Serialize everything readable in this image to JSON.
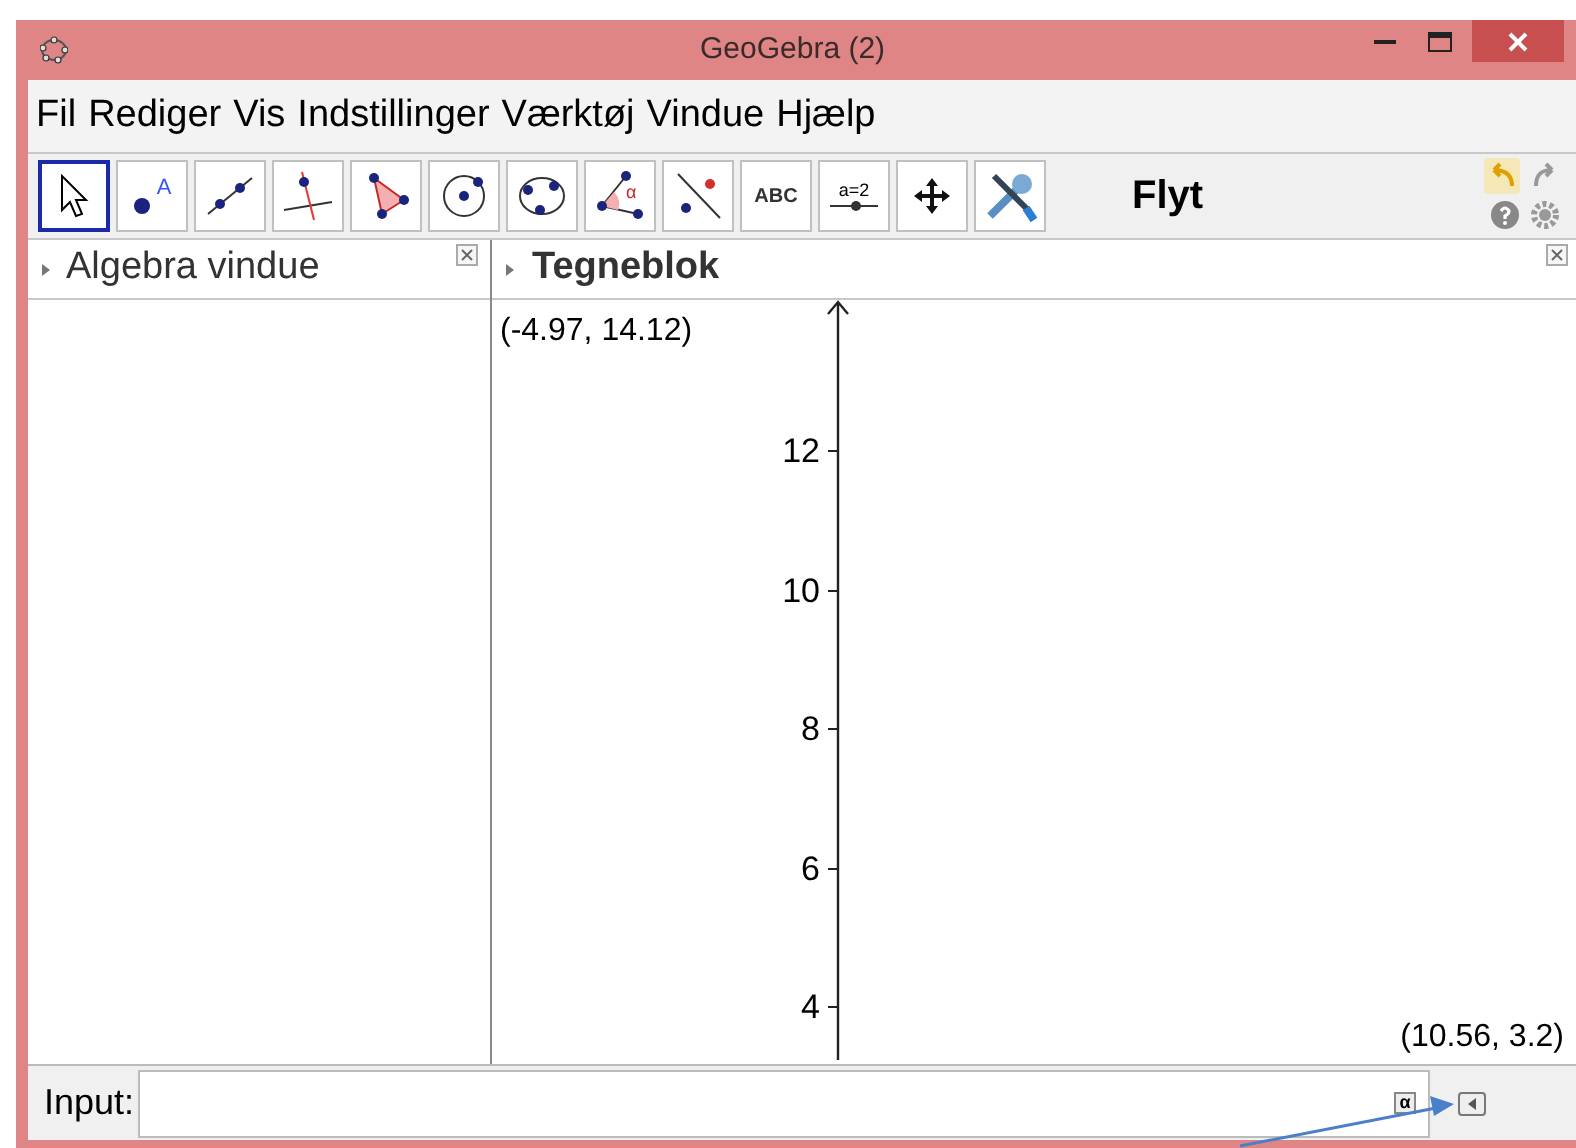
{
  "window": {
    "title": "GeoGebra (2)"
  },
  "menu": [
    "Fil",
    "Rediger",
    "Vis",
    "Indstillinger",
    "Værktøj",
    "Vindue",
    "Hjælp"
  ],
  "toolbar": {
    "tools": [
      {
        "kind": "pointer",
        "selected": true
      },
      {
        "kind": "point",
        "label": "A",
        "selected": false
      },
      {
        "kind": "line",
        "selected": false
      },
      {
        "kind": "perpendicular",
        "selected": false
      },
      {
        "kind": "polygon",
        "selected": false
      },
      {
        "kind": "circle",
        "selected": false
      },
      {
        "kind": "conic",
        "selected": false
      },
      {
        "kind": "angle",
        "label": "α",
        "selected": false
      },
      {
        "kind": "reflect",
        "selected": false
      },
      {
        "kind": "text",
        "label": "ABC",
        "selected": false
      },
      {
        "kind": "slider",
        "label": "a=2",
        "selected": false
      },
      {
        "kind": "move",
        "selected": false
      },
      {
        "kind": "tools",
        "selected": false
      }
    ],
    "tool_name": "Flyt"
  },
  "algebra_view": {
    "title": "Algebra vindue"
  },
  "graphics_view": {
    "title": "Tegneblok",
    "top_left": "(-4.97, 14.12)",
    "bottom_right": "(10.56, 3.2)",
    "y_ticks": [
      "12",
      "10",
      "8",
      "6",
      "4"
    ]
  },
  "input_bar": {
    "label": "Input:",
    "alpha_button": "α"
  }
}
